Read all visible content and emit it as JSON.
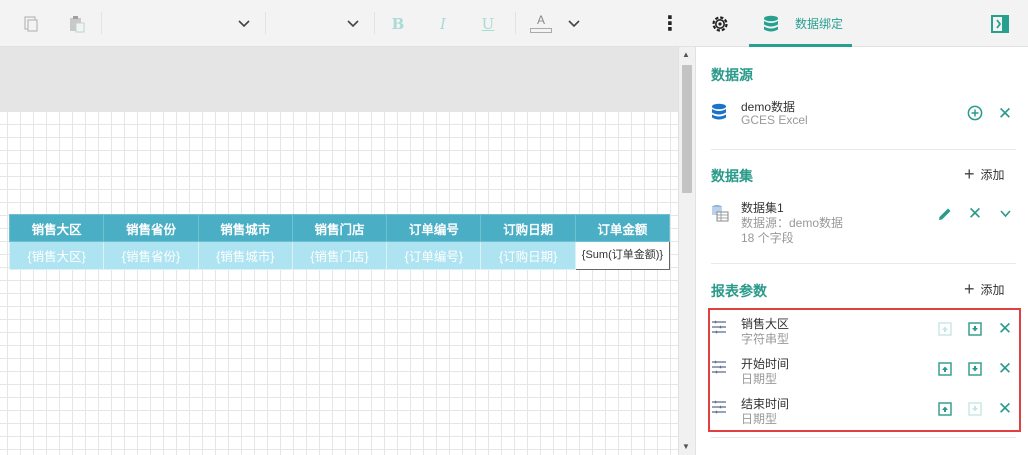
{
  "toolbar": {
    "tab_label": "数据绑定",
    "bold": "B",
    "italic": "I",
    "underline": "U",
    "font_color": "A"
  },
  "table": {
    "headers": [
      "销售大区",
      "销售省份",
      "销售城市",
      "销售门店",
      "订单编号",
      "订购日期",
      "订单金额"
    ],
    "fields": [
      "{销售大区}",
      "{销售省份}",
      "{销售城市}",
      "{销售门店}",
      "{订单编号}",
      "{订购日期}",
      "{Sum(订单金额)}"
    ]
  },
  "panel": {
    "datasource": {
      "title": "数据源",
      "name": "demo数据",
      "type": "GCES Excel"
    },
    "dataset": {
      "title": "数据集",
      "add_label": "添加",
      "name": "数据集1",
      "source": "数据源：demo数据",
      "fields": "18 个字段"
    },
    "params": {
      "title": "报表参数",
      "add_label": "添加",
      "items": [
        {
          "name": "销售大区",
          "type": "字符串型"
        },
        {
          "name": "开始时间",
          "type": "日期型"
        },
        {
          "name": "结束时间",
          "type": "日期型"
        }
      ]
    }
  },
  "colors": {
    "accent": "#27a090",
    "header_bg": "#4aaec4",
    "field_bg": "#aee4f2",
    "highlight": "#e0403f"
  }
}
